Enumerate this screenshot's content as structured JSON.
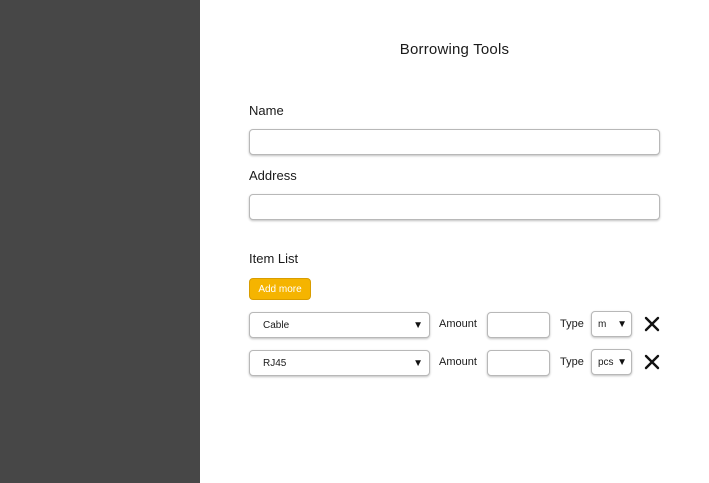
{
  "page": {
    "title": "Borrowing Tools"
  },
  "form": {
    "name_label": "Name",
    "name_value": "",
    "address_label": "Address",
    "address_value": ""
  },
  "items_section": {
    "label": "Item List",
    "add_button_label": "Add more",
    "amount_label": "Amount",
    "type_label": "Type",
    "rows": [
      {
        "item": "Cable",
        "amount": "",
        "type": "m"
      },
      {
        "item": "RJ45",
        "amount": "",
        "type": "pcs"
      }
    ]
  },
  "icons": {
    "dropdown": "caret-down-icon",
    "remove": "close-icon"
  },
  "colors": {
    "sidebar": "#474747",
    "accent": "#f5b400"
  }
}
